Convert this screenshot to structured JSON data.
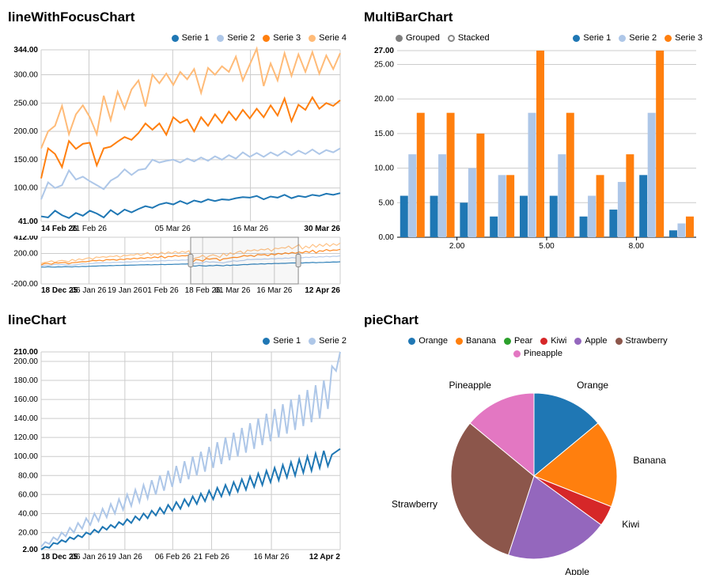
{
  "sections": {
    "lineFocus": {
      "title": "lineWithFocusChart"
    },
    "multiBar": {
      "title": "MultiBarChart"
    },
    "lineChart": {
      "title": "lineChart"
    },
    "pieChart": {
      "title": "pieChart"
    }
  },
  "legends": {
    "lineFocus": [
      "Serie 1",
      "Serie 2",
      "Serie 3",
      "Serie 4"
    ],
    "multiBar": {
      "modes": [
        "Grouped",
        "Stacked"
      ],
      "series": [
        "Serie 1",
        "Serie 2",
        "Serie 3"
      ]
    },
    "lineChart": [
      "Serie 1",
      "Serie 2"
    ],
    "pie": [
      "Orange",
      "Banana",
      "Pear",
      "Kiwi",
      "Apple",
      "Strawberry",
      "Pineapple"
    ]
  },
  "colors": {
    "s1": "#1f77b4",
    "s2": "#aec7e8",
    "s3": "#ff7f0e",
    "s4": "#ffbb78",
    "green": "#2ca02c",
    "red": "#d62728",
    "purple": "#9467bd",
    "brown": "#8c564b",
    "pink": "#e377c2",
    "grey": "#7f7f7f"
  },
  "chart_data": [
    {
      "id": "lineWithFocusChart_main",
      "type": "line",
      "title": "lineWithFocusChart",
      "x_ticks": [
        "14 Feb 26",
        "21 Feb 26",
        "05 Mar 26",
        "16 Mar 26",
        "30 Mar 26"
      ],
      "y_ticks": [
        41,
        100,
        150,
        200,
        250,
        300,
        344
      ],
      "ylim": [
        41,
        344
      ],
      "series": [
        {
          "name": "Serie 1",
          "color": "#1f77b4",
          "values": [
            50,
            48,
            60,
            52,
            47,
            56,
            51,
            60,
            55,
            48,
            61,
            53,
            62,
            57,
            63,
            68,
            65,
            71,
            74,
            71,
            77,
            72,
            78,
            75,
            80,
            77,
            80,
            79,
            82,
            84,
            83,
            86,
            80,
            85,
            83,
            88,
            82,
            86,
            84,
            88,
            86,
            90,
            88,
            91
          ]
        },
        {
          "name": "Serie 2",
          "color": "#aec7e8",
          "values": [
            80,
            110,
            100,
            105,
            131,
            115,
            120,
            112,
            105,
            98,
            113,
            120,
            133,
            123,
            132,
            134,
            150,
            145,
            148,
            150,
            145,
            152,
            147,
            154,
            148,
            156,
            150,
            158,
            152,
            163,
            155,
            162,
            155,
            163,
            157,
            165,
            158,
            166,
            160,
            168,
            160,
            167,
            163,
            170
          ]
        },
        {
          "name": "Serie 3",
          "color": "#ff7f0e",
          "values": [
            117,
            170,
            160,
            137,
            183,
            169,
            178,
            180,
            140,
            170,
            173,
            182,
            190,
            185,
            197,
            214,
            203,
            214,
            194,
            225,
            215,
            221,
            200,
            225,
            210,
            230,
            215,
            235,
            220,
            238,
            223,
            240,
            225,
            246,
            228,
            258,
            218,
            247,
            238,
            260,
            240,
            250,
            245,
            255
          ]
        },
        {
          "name": "Serie 4",
          "color": "#ffbb78",
          "values": [
            170,
            200,
            210,
            245,
            195,
            230,
            246,
            225,
            195,
            263,
            220,
            270,
            240,
            274,
            290,
            244,
            300,
            285,
            302,
            282,
            305,
            292,
            310,
            268,
            312,
            300,
            315,
            305,
            332,
            290,
            318,
            346,
            280,
            320,
            290,
            338,
            298,
            336,
            305,
            340,
            302,
            334,
            310,
            338
          ]
        }
      ]
    },
    {
      "id": "lineWithFocusChart_context",
      "type": "line",
      "x_ticks": [
        "18 Dec 25",
        "06 Jan 26",
        "19 Jan 26",
        "01 Feb 26",
        "18 Feb 26",
        "01 Mar 26",
        "16 Mar 26",
        "12 Apr 26"
      ],
      "y_ticks": [
        "-200.00",
        "200.00",
        "412.00"
      ],
      "ylim": [
        -200,
        412
      ],
      "brush": {
        "start": "14 Feb 26",
        "end": "30 Mar 26"
      }
    },
    {
      "id": "MultiBarChart",
      "type": "bar",
      "title": "MultiBarChart",
      "mode": "Grouped",
      "x_ticks": [
        "2.00",
        "5.00",
        "8.00"
      ],
      "y_ticks": [
        "0.00",
        "5.00",
        "10.00",
        "15.00",
        "20.00",
        "25.00",
        "27.00"
      ],
      "ylim": [
        0,
        27
      ],
      "categories": [
        1,
        2,
        3,
        4,
        5,
        6,
        7,
        8,
        9
      ],
      "series": [
        {
          "name": "Serie 1",
          "color": "#1f77b4",
          "values": [
            6,
            6,
            5,
            3,
            6,
            6,
            3,
            4,
            9,
            1
          ]
        },
        {
          "name": "Serie 2",
          "color": "#aec7e8",
          "values": [
            12,
            12,
            10,
            9,
            18,
            12,
            6,
            8,
            18,
            2
          ]
        },
        {
          "name": "Serie 3",
          "color": "#ff7f0e",
          "values": [
            18,
            18,
            15,
            9,
            27,
            18,
            9,
            12,
            27,
            3
          ]
        }
      ]
    },
    {
      "id": "lineChart",
      "type": "line",
      "title": "lineChart",
      "x_ticks": [
        "18 Dec 25",
        "06 Jan 26",
        "19 Jan 26",
        "06 Feb 26",
        "21 Feb 26",
        "16 Mar 26",
        "12 Apr 2"
      ],
      "y_ticks": [
        "2.00",
        "20.00",
        "40.00",
        "60.00",
        "80.00",
        "100.00",
        "120.00",
        "140.00",
        "160.00",
        "180.00",
        "200.00",
        "210.00"
      ],
      "ylim": [
        2,
        210
      ],
      "series": [
        {
          "name": "Serie 1",
          "color": "#1f77b4",
          "values": [
            2,
            5,
            4,
            9,
            8,
            12,
            10,
            15,
            13,
            17,
            15,
            20,
            18,
            23,
            20,
            26,
            23,
            28,
            25,
            31,
            28,
            34,
            30,
            37,
            33,
            40,
            35,
            43,
            38,
            46,
            40,
            49,
            43,
            52,
            45,
            55,
            48,
            58,
            50,
            61,
            53,
            64,
            55,
            67,
            58,
            70,
            60,
            73,
            63,
            76,
            65,
            79,
            68,
            82,
            70,
            85,
            73,
            88,
            75,
            91,
            78,
            94,
            80,
            97,
            83,
            100,
            85,
            103,
            88,
            106,
            90,
            102,
            105,
            108
          ]
        },
        {
          "name": "Serie 2",
          "color": "#aec7e8",
          "values": [
            5,
            10,
            8,
            15,
            12,
            20,
            16,
            25,
            20,
            30,
            24,
            35,
            28,
            40,
            32,
            45,
            36,
            50,
            40,
            55,
            44,
            60,
            48,
            65,
            52,
            70,
            56,
            75,
            60,
            80,
            64,
            85,
            68,
            90,
            72,
            95,
            76,
            100,
            80,
            105,
            84,
            110,
            88,
            115,
            92,
            120,
            96,
            125,
            100,
            130,
            104,
            135,
            108,
            140,
            112,
            145,
            116,
            150,
            120,
            155,
            124,
            160,
            128,
            165,
            132,
            170,
            136,
            175,
            140,
            180,
            150,
            195,
            190,
            210
          ]
        }
      ]
    },
    {
      "id": "pieChart",
      "type": "pie",
      "title": "pieChart",
      "slices": [
        {
          "label": "Orange",
          "value": 14,
          "color": "#1f77b4"
        },
        {
          "label": "Banana",
          "value": 17,
          "color": "#ff7f0e"
        },
        {
          "label": "Pear",
          "value": 0,
          "color": "#2ca02c"
        },
        {
          "label": "Kiwi",
          "value": 4,
          "color": "#d62728"
        },
        {
          "label": "Apple",
          "value": 20,
          "color": "#9467bd"
        },
        {
          "label": "Strawberry",
          "value": 31,
          "color": "#8c564b"
        },
        {
          "label": "Pineapple",
          "value": 14,
          "color": "#e377c2"
        }
      ]
    }
  ]
}
